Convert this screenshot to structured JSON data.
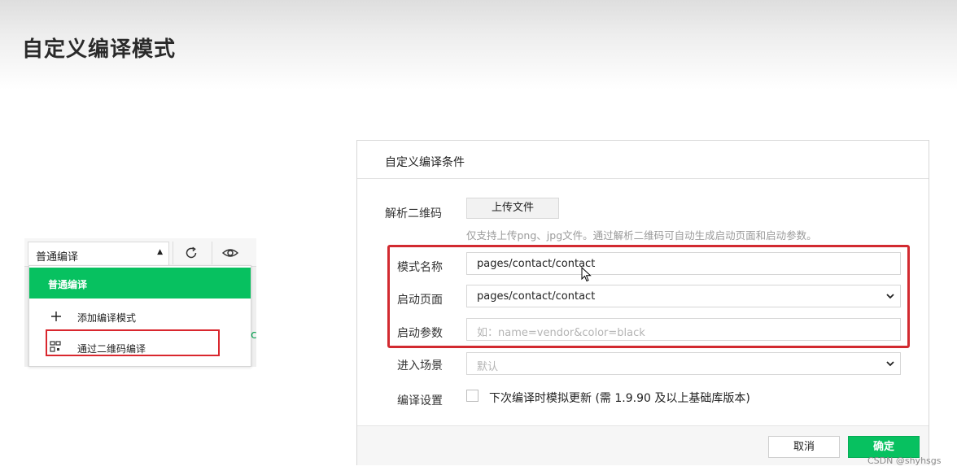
{
  "slide": {
    "title": "自定义编译模式"
  },
  "compile_dropdown": {
    "selected": "普通编译",
    "menu": [
      {
        "label": "普通编译",
        "icon": "none",
        "active": true
      },
      {
        "label": "添加编译模式",
        "icon": "plus-icon",
        "active": false
      },
      {
        "label": "通过二维码编译",
        "icon": "qrcode-icon",
        "active": false
      }
    ],
    "refresh_icon": "refresh-icon",
    "preview_icon": "eye-icon",
    "stray_text": "c"
  },
  "dialog": {
    "title": "自定义编译条件",
    "parse_qr": {
      "label": "解析二维码",
      "upload_label": "上传文件",
      "hint": "仅支持上传png、jpg文件。通过解析二维码可自动生成启动页面和启动参数。"
    },
    "mode_name": {
      "label": "模式名称",
      "value": "pages/contact/contact"
    },
    "start_page": {
      "label": "启动页面",
      "value": "pages/contact/contact"
    },
    "start_params": {
      "label": "启动参数",
      "value": "",
      "placeholder": "如：name=vendor&color=black"
    },
    "scene": {
      "label": "进入场景",
      "value": "默认"
    },
    "compile_settings": {
      "label": "编译设置",
      "checkbox_label": "下次编译时模拟更新 (需 1.9.90 及以上基础库版本)",
      "checked": false
    },
    "cancel_label": "取消",
    "ok_label": "确定"
  },
  "watermark": "CSDN @shyhsgs",
  "colors": {
    "accent_green": "#07c160",
    "highlight_red": "#d22a30"
  }
}
